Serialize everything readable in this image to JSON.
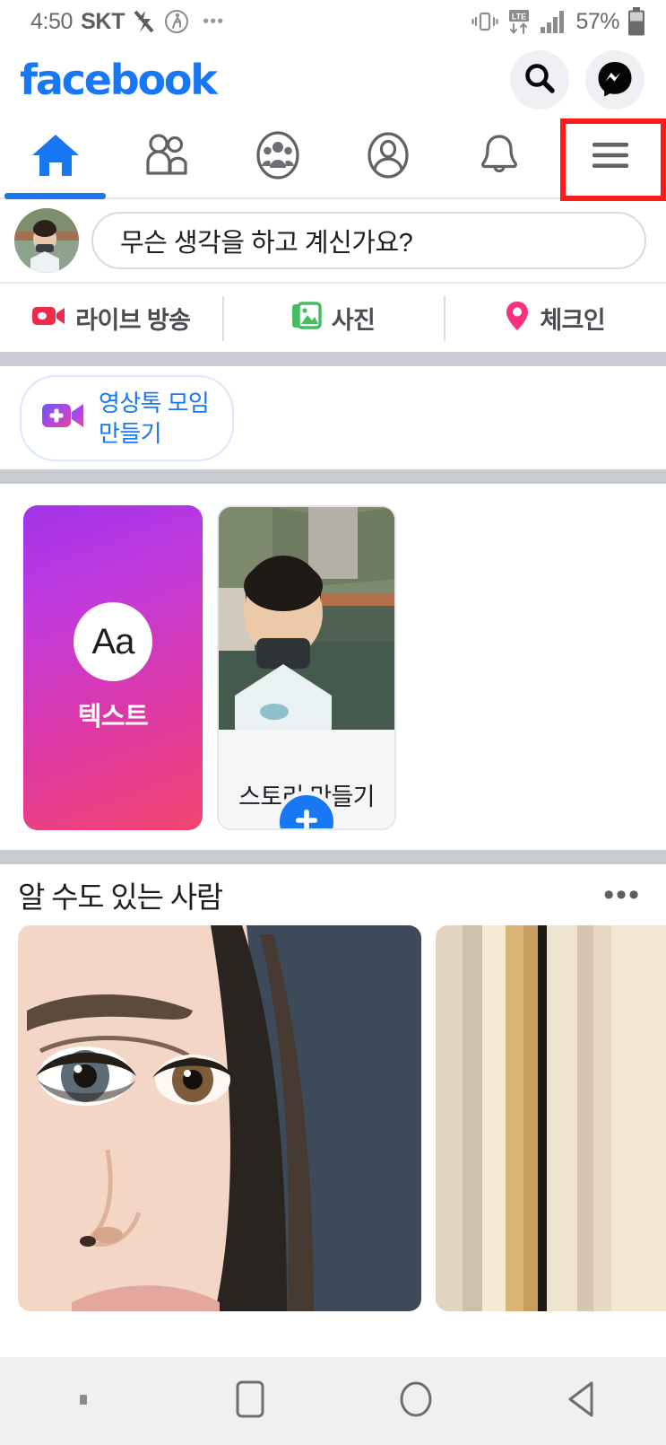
{
  "status_bar": {
    "time": "4:50",
    "carrier": "SKT",
    "icons": [
      "mute-icon",
      "pedestrian-icon",
      "overflow-dots-icon",
      "vibrate-icon",
      "lte-data-icon",
      "signal-bars-icon",
      "battery-icon"
    ],
    "battery_percent": "57%"
  },
  "header": {
    "logo": "facebook",
    "logo_color": "#1877F2",
    "search_label": "search-icon",
    "messenger_label": "messenger-icon"
  },
  "tabs": [
    {
      "name": "home",
      "icon": "home-icon",
      "active": true
    },
    {
      "name": "friends",
      "icon": "friends-icon",
      "active": false
    },
    {
      "name": "groups",
      "icon": "groups-icon",
      "active": false
    },
    {
      "name": "profile",
      "icon": "profile-icon",
      "active": false
    },
    {
      "name": "notifications",
      "icon": "bell-icon",
      "active": false
    },
    {
      "name": "menu",
      "icon": "hamburger-menu-icon",
      "active": false,
      "highlighted": true
    }
  ],
  "highlight": {
    "color": "#FF1A1A",
    "target": "menu"
  },
  "composer": {
    "placeholder": "무슨 생각을 하고 계신가요?",
    "avatar": "user-avatar"
  },
  "composer_actions": [
    {
      "label": "라이브 방송",
      "icon": "live-video-icon",
      "color": "#F02849"
    },
    {
      "label": "사진",
      "icon": "photo-icon",
      "color": "#45BD62"
    },
    {
      "label": "체크인",
      "icon": "location-pin-icon",
      "color": "#F5327E"
    }
  ],
  "rooms": {
    "label_line1": "영상톡 모임",
    "label_line2": "만들기",
    "icon": "video-room-icon",
    "color": "#1877F2"
  },
  "stories": [
    {
      "type": "text",
      "label": "텍스트",
      "glyph": "Aa"
    },
    {
      "type": "create",
      "label": "스토리 만들기",
      "icon": "plus-icon"
    }
  ],
  "pymk": {
    "title": "알 수도 있는 사람",
    "menu": "•••",
    "cards": [
      {
        "name": "suggestion-photo-1"
      },
      {
        "name": "suggestion-photo-2"
      }
    ]
  },
  "navbar": [
    {
      "name": "nav-dot",
      "icon": "dot-icon"
    },
    {
      "name": "nav-recents",
      "icon": "square-icon"
    },
    {
      "name": "nav-home",
      "icon": "circle-icon"
    },
    {
      "name": "nav-back",
      "icon": "triangle-back-icon"
    }
  ]
}
